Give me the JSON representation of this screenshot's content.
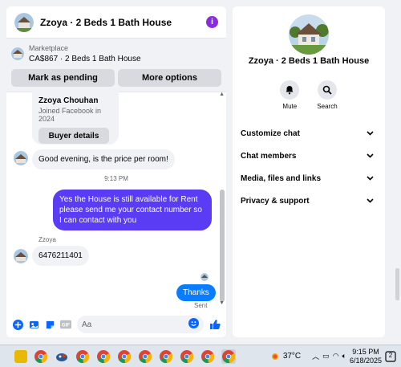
{
  "header": {
    "title": "Zzoya · 2 Beds 1 Bath House"
  },
  "marketplace": {
    "label": "Marketplace",
    "item": "CA$867 · 2 Beds 1 Bath House",
    "mark_pending": "Mark as pending",
    "more_options": "More options"
  },
  "profile_card": {
    "name": "Zzoya Chouhan",
    "joined": "Joined Facebook in 2024",
    "button": "Buyer details"
  },
  "messages": {
    "in1": "Good evening, is the price per room!",
    "time": "9:13 PM",
    "out1": "Yes the House is still available for Rent please send me your contact number so I can contact with you",
    "sender": "Zzoya",
    "in2": "6476211401",
    "sent_msg": "Thanks",
    "sent_label": "Sent"
  },
  "composer": {
    "placeholder": "Aa"
  },
  "info_panel": {
    "title": "Zzoya · 2 Beds 1 Bath House",
    "actions": [
      {
        "label": "Mute"
      },
      {
        "label": "Search"
      }
    ],
    "rows": [
      {
        "label": "Customize chat"
      },
      {
        "label": "Chat members"
      },
      {
        "label": "Media, files and links"
      },
      {
        "label": "Privacy & support"
      }
    ]
  },
  "taskbar": {
    "temperature": "37°C",
    "time": "9:15 PM",
    "date": "6/18/2025",
    "notifications": "2"
  },
  "colors": {
    "outgoing": "#5b3cf5",
    "sent": "#0a7cff",
    "accent": "#0866ff",
    "info": "#8a2be2"
  }
}
